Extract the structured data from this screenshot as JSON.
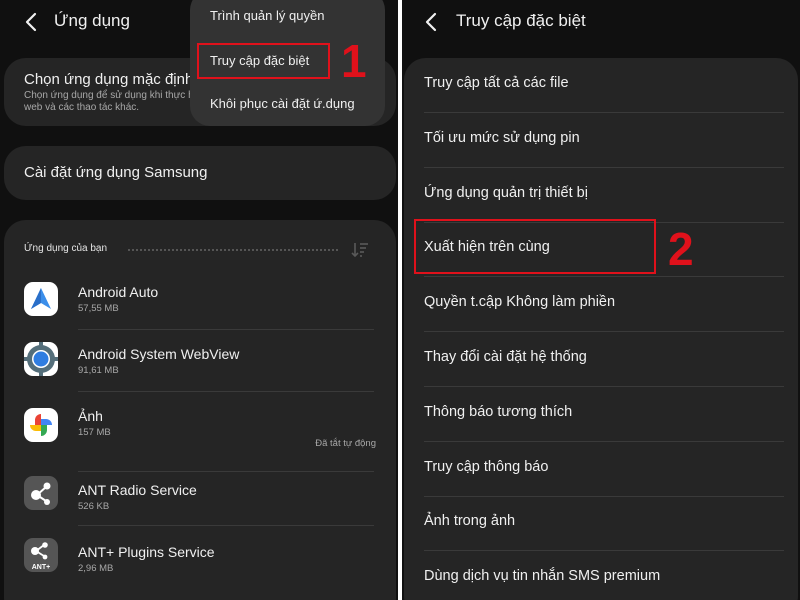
{
  "left_screen": {
    "header": {
      "title": "Ứng dụng"
    },
    "default_apps": {
      "title": "Chọn ứng dụng mặc định",
      "subtitle_line1": "Chọn ứng dụng để sử dụng khi thực h",
      "subtitle_line2": "web và các thao tác khác."
    },
    "samsung_settings": {
      "title": "Cài đặt ứng dụng Samsung"
    },
    "apps_section": {
      "label": "Ứng dụng của bạn",
      "items": [
        {
          "name": "Android Auto",
          "size": "57,55 MB",
          "status": "",
          "icon": "android-auto-icon"
        },
        {
          "name": "Android System WebView",
          "size": "91,61 MB",
          "status": "",
          "icon": "webview-icon"
        },
        {
          "name": "Ảnh",
          "size": "157 MB",
          "status": "Đã tắt tự động",
          "icon": "photos-icon"
        },
        {
          "name": "ANT Radio Service",
          "size": "526 KB",
          "status": "",
          "icon": "ant-radio-icon"
        },
        {
          "name": "ANT+ Plugins Service",
          "size": "2,96 MB",
          "status": "",
          "icon": "ant-plus-icon"
        }
      ],
      "ant_plus_badge": "ANT+"
    },
    "popup_menu": {
      "items": [
        "Trình quản lý quyền",
        "Truy cập đặc biệt",
        "Khôi phục cài đặt ứ.dụng"
      ]
    },
    "step_label": "1"
  },
  "right_screen": {
    "header": {
      "title": "Truy cập đặc biệt"
    },
    "items": [
      "Truy cập tất cả các file",
      "Tối ưu mức sử dụng pin",
      "Ứng dụng quản trị thiết bị",
      "Xuất hiện trên cùng",
      "Quyền t.cập Không làm phiền",
      "Thay đổi cài đặt hệ thống",
      "Thông báo tương thích",
      "Truy cập thông báo",
      "Ảnh trong ảnh",
      "Dùng dịch vụ tin nhắn SMS premium"
    ],
    "step_label": "2"
  },
  "colors": {
    "background": "#101010",
    "card": "#252525",
    "popup": "#333333",
    "highlight": "#e0111b",
    "android_auto_blue": "#3b8eea"
  }
}
